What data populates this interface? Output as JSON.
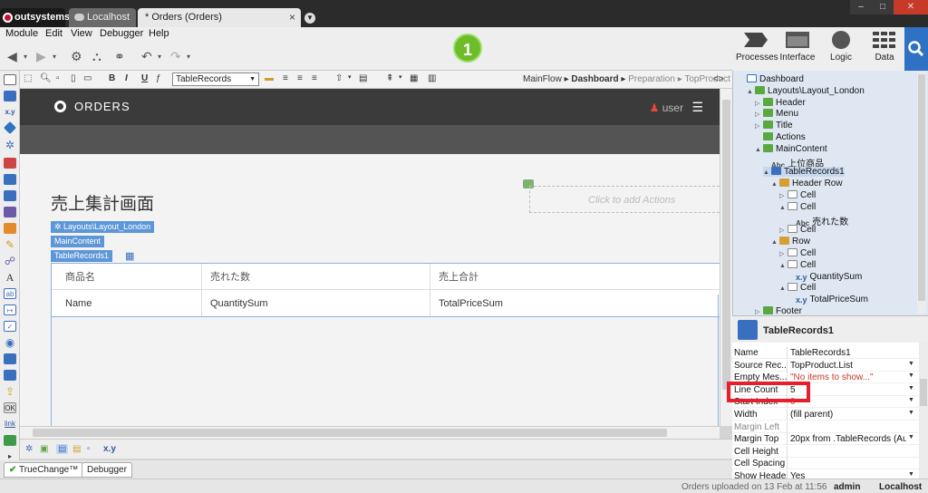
{
  "window": {
    "tabs": [
      {
        "label": "outsystems"
      },
      {
        "label": "Localhost"
      },
      {
        "label": "* Orders (Orders)"
      }
    ],
    "controls": {
      "minimize": "–",
      "maximize": "□",
      "close": "✕"
    }
  },
  "menu": [
    "Module",
    "Edit",
    "View",
    "Debugger",
    "Help"
  ],
  "step_badge": "1",
  "right_toolbar": [
    {
      "label": "Processes",
      "icon": "processes-icon"
    },
    {
      "label": "Interface",
      "icon": "interface-icon"
    },
    {
      "label": "Logic",
      "icon": "logic-icon"
    },
    {
      "label": "Data",
      "icon": "data-icon"
    }
  ],
  "format_toolbar": {
    "bold": "B",
    "italic": "I",
    "underline": "U",
    "widget_select": "TableRecords"
  },
  "breadcrumb": {
    "items": [
      "MainFlow",
      "Dashboard",
      "Preparation",
      "TopProduct"
    ],
    "separator": "▸"
  },
  "tree_toggle": "<>",
  "canvas": {
    "app_title": "ORDERS",
    "user": "user",
    "page_title": "売上集計画面",
    "click_actions": "Click to add Actions",
    "tags": {
      "layout": "Layouts\\Layout_London",
      "main": "MainContent",
      "table": "TableRecords1"
    },
    "table": {
      "headers": [
        "商品名",
        "売れた数",
        "売上合計"
      ],
      "row": [
        "Name",
        "QuantitySum",
        "TotalPriceSum"
      ]
    }
  },
  "bottom_tabs": [
    "TrueChange™",
    "Debugger"
  ],
  "bottom_widgets": {
    "expr": "x.y"
  },
  "status": {
    "message": "Orders uploaded on 13 Feb at 11:56",
    "user": "admin",
    "host": "Localhost"
  },
  "tree": [
    {
      "label": "Dashboard",
      "icon": "page",
      "depth": 0,
      "exp": ""
    },
    {
      "label": "Layouts\\Layout_London",
      "icon": "layout",
      "depth": 1,
      "exp": "▲"
    },
    {
      "label": "Header",
      "icon": "place",
      "depth": 2,
      "exp": "▷"
    },
    {
      "label": "Menu",
      "icon": "place",
      "depth": 2,
      "exp": "▷"
    },
    {
      "label": "Title",
      "icon": "place",
      "depth": 2,
      "exp": "▷"
    },
    {
      "label": "Actions",
      "icon": "place",
      "depth": 2,
      "exp": ""
    },
    {
      "label": "MainContent",
      "icon": "place",
      "depth": 2,
      "exp": "▲"
    },
    {
      "label": "上位商品",
      "icon": "text",
      "depth": 3,
      "exp": ""
    },
    {
      "label": "TableRecords1",
      "icon": "table",
      "depth": 3,
      "exp": "▲"
    },
    {
      "label": "Header Row",
      "icon": "row",
      "depth": 4,
      "exp": "▲"
    },
    {
      "label": "Cell",
      "icon": "cell",
      "depth": 5,
      "exp": "▷"
    },
    {
      "label": "Cell",
      "icon": "cell",
      "depth": 5,
      "exp": "▲"
    },
    {
      "label": "売れた数",
      "icon": "text",
      "depth": 6,
      "exp": ""
    },
    {
      "label": "Cell",
      "icon": "cell",
      "depth": 5,
      "exp": "▷"
    },
    {
      "label": "Row",
      "icon": "row",
      "depth": 4,
      "exp": "▲"
    },
    {
      "label": "Cell",
      "icon": "cell",
      "depth": 5,
      "exp": "▷"
    },
    {
      "label": "Cell",
      "icon": "cell",
      "depth": 5,
      "exp": "▲"
    },
    {
      "label": "QuantitySum",
      "icon": "expr",
      "depth": 6,
      "exp": ""
    },
    {
      "label": "Cell",
      "icon": "cell",
      "depth": 5,
      "exp": "▲"
    },
    {
      "label": "TotalPriceSum",
      "icon": "expr",
      "depth": 6,
      "exp": ""
    },
    {
      "label": "Footer",
      "icon": "place",
      "depth": 2,
      "exp": "▷"
    }
  ],
  "properties": {
    "title": "TableRecords1",
    "rows": [
      {
        "name": "Name",
        "value": "TableRecords1",
        "dd": false,
        "dim": false,
        "red": false
      },
      {
        "name": "Source Rec...",
        "value": "TopProduct.List",
        "dd": true,
        "dim": false,
        "red": false
      },
      {
        "name": "Empty Mes...",
        "value": "\"No items to show...\"",
        "dd": true,
        "dim": false,
        "red": true
      },
      {
        "name": "Line Count",
        "value": "5",
        "dd": true,
        "dim": false,
        "red": false
      },
      {
        "name": "Start Index",
        "value": "0",
        "dd": true,
        "dim": false,
        "red": true
      },
      {
        "name": "Width",
        "value": "(fill parent)",
        "dd": true,
        "dim": false,
        "red": false
      },
      {
        "name": "Margin Left",
        "value": "",
        "dd": false,
        "dim": true,
        "red": false
      },
      {
        "name": "Margin Top",
        "value": "20px from .TableRecords (Au",
        "dd": true,
        "dim": false,
        "red": false
      },
      {
        "name": "Cell Height",
        "value": "",
        "dd": false,
        "dim": false,
        "red": false
      },
      {
        "name": "Cell Spacing",
        "value": "",
        "dd": false,
        "dim": false,
        "red": false
      },
      {
        "name": "Show Header",
        "value": "Yes",
        "dd": true,
        "dim": false,
        "red": false
      }
    ]
  },
  "colors": {
    "accent_blue": "#2f72c4",
    "badge_green": "#6cbd28",
    "highlight_red": "#e5202a",
    "header_dark": "#3b3b3b"
  }
}
